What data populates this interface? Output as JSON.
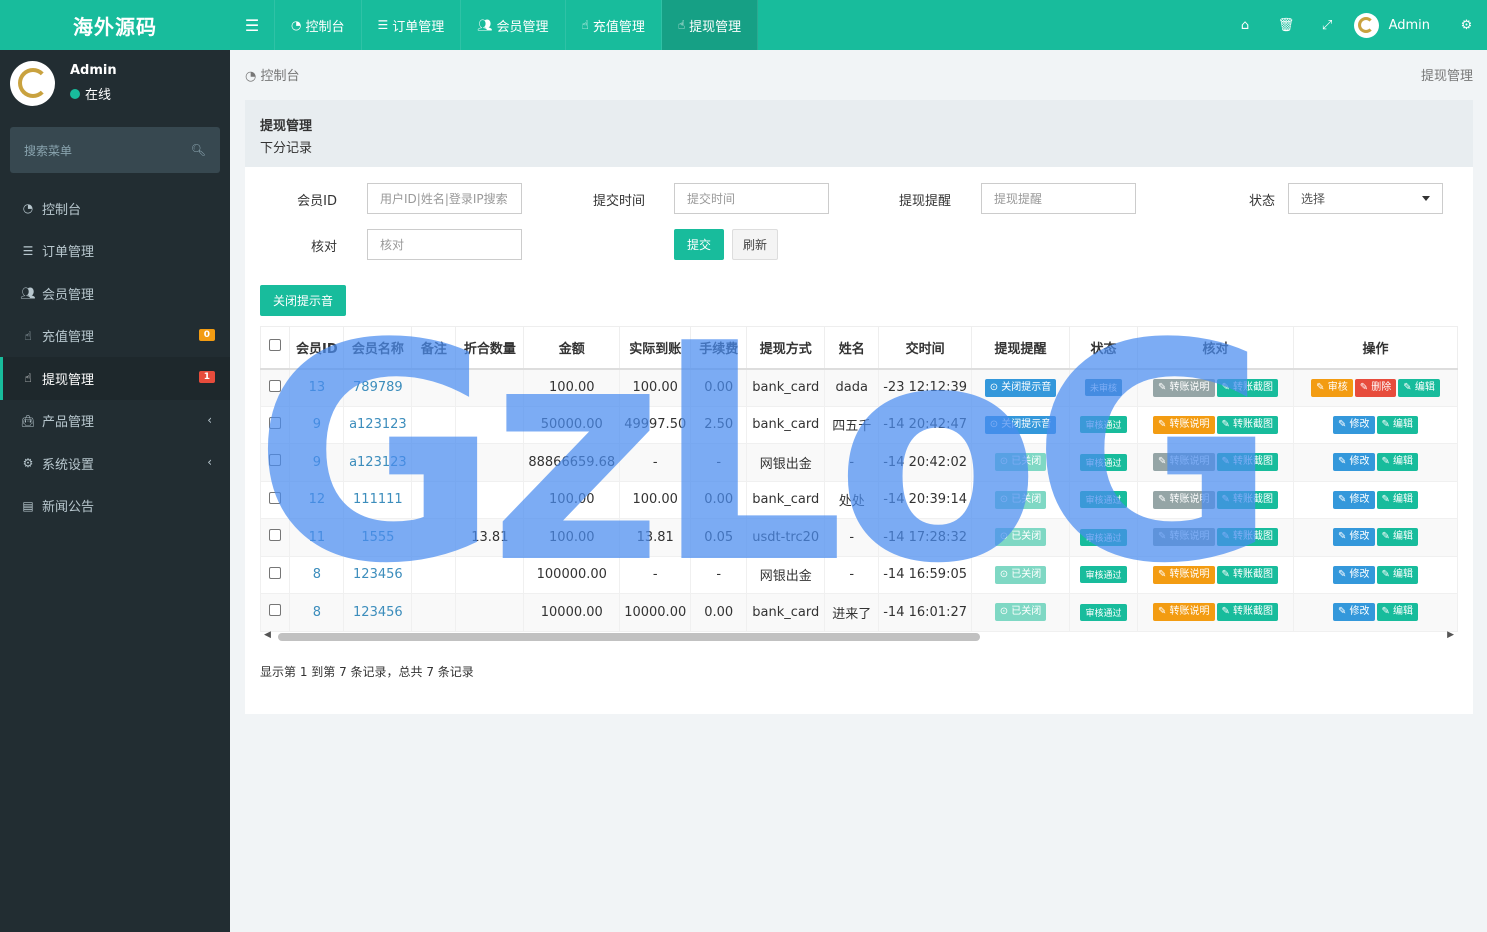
{
  "app": {
    "logo_text": "海外源码"
  },
  "user": {
    "name": "Admin",
    "status": "在线"
  },
  "sidebar": {
    "search_placeholder": "搜索菜单",
    "items": [
      {
        "label": "控制台",
        "icon": "dashboard-icon"
      },
      {
        "label": "订单管理",
        "icon": "list-icon"
      },
      {
        "label": "会员管理",
        "icon": "users-icon"
      },
      {
        "label": "充值管理",
        "icon": "hand-icon",
        "badge": "0"
      },
      {
        "label": "提现管理",
        "icon": "hand-icon",
        "badge": "1",
        "active": true
      },
      {
        "label": "产品管理",
        "icon": "shopping-bag-icon",
        "arrow": "‹"
      },
      {
        "label": "系统设置",
        "icon": "cogs-icon",
        "arrow": "‹"
      },
      {
        "label": "新闻公告",
        "icon": "newspaper-icon"
      }
    ]
  },
  "header": {
    "tabs": [
      {
        "label": "控制台"
      },
      {
        "label": "订单管理"
      },
      {
        "label": "会员管理"
      },
      {
        "label": "充值管理"
      },
      {
        "label": "提现管理",
        "active": true
      }
    ],
    "user_name": "Admin"
  },
  "breadcrumb": {
    "home": "控制台",
    "current": "提现管理"
  },
  "panel": {
    "title": "提现管理",
    "subtitle": "下分记录"
  },
  "filters": {
    "member_id_label": "会员ID",
    "member_id_placeholder": "用户ID|姓名|登录IP搜索",
    "submit_time_label": "提交时间",
    "submit_time_placeholder": "提交时间",
    "remind_label": "提现提醒",
    "remind_placeholder": "提现提醒",
    "status_label": "状态",
    "status_value": "选择",
    "check_label": "核对",
    "check_placeholder": "核对",
    "submit_button": "提交",
    "refresh_button": "刷新"
  },
  "toolbar": {
    "close_sound_button": "关闭提示音"
  },
  "table": {
    "headers": [
      "会员ID",
      "会员名称",
      "备注",
      "折合数量",
      "金额",
      "实际到账",
      "手续费",
      "提现方式",
      "姓名",
      "交时间",
      "提现提醒",
      "状态",
      "核对",
      "操作"
    ],
    "rows": [
      {
        "id": "13",
        "name": "789789",
        "note": "",
        "converted": "",
        "amount": "100.00",
        "actual": "100.00",
        "fee": "0.00",
        "method": "bank_card",
        "real_name": "dada",
        "time": "-23 12:12:39",
        "remind": "关闭提示音",
        "status": "未审核",
        "check1": "转账说明",
        "check2": "转账截图",
        "actions": [
          "审核",
          "删除",
          "编辑"
        ]
      },
      {
        "id": "9",
        "name": "a123123",
        "note": "",
        "converted": "",
        "amount": "50000.00",
        "actual": "49997.50",
        "fee": "2.50",
        "method": "bank_card",
        "real_name": "四五千",
        "time": "-14 20:42:47",
        "remind": "关闭提示音",
        "status": "审核通过",
        "check1": "转账说明",
        "check2": "转账截图",
        "actions": [
          "修改",
          "编辑"
        ]
      },
      {
        "id": "9",
        "name": "a123123",
        "note": "",
        "converted": "",
        "amount": "88866659.68",
        "actual": "-",
        "fee": "-",
        "method": "网银出金",
        "real_name": "-",
        "time": "-14 20:42:02",
        "remind": "已关闭",
        "status": "审核通过",
        "check1": "转账说明",
        "check2": "转账截图",
        "actions": [
          "修改",
          "编辑"
        ]
      },
      {
        "id": "12",
        "name": "111111",
        "note": "",
        "converted": "",
        "amount": "100.00",
        "actual": "100.00",
        "fee": "0.00",
        "method": "bank_card",
        "real_name": "处处",
        "time": "-14 20:39:14",
        "remind": "已关闭",
        "status": "审核通过",
        "check1": "转账说明",
        "check2": "转账截图",
        "actions": [
          "修改",
          "编辑"
        ]
      },
      {
        "id": "11",
        "name": "1555",
        "note": "",
        "converted": "13.81",
        "amount": "100.00",
        "actual": "13.81",
        "fee": "0.05",
        "method": "usdt-trc20",
        "real_name": "-",
        "time": "-14 17:28:32",
        "remind": "已关闭",
        "status": "审核通过",
        "check1": "转账说明",
        "check2": "转账截图",
        "actions": [
          "修改",
          "编辑"
        ]
      },
      {
        "id": "8",
        "name": "123456",
        "note": "",
        "converted": "",
        "amount": "100000.00",
        "actual": "-",
        "fee": "-",
        "method": "网银出金",
        "real_name": "-",
        "time": "-14 16:59:05",
        "remind": "已关闭",
        "status": "审核通过",
        "check1": "转账说明",
        "check2": "转账截图",
        "actions": [
          "修改",
          "编辑"
        ]
      },
      {
        "id": "8",
        "name": "123456",
        "note": "",
        "converted": "",
        "amount": "10000.00",
        "actual": "10000.00",
        "fee": "0.00",
        "method": "bank_card",
        "real_name": "进来了",
        "time": "-14 16:01:27",
        "remind": "已关闭",
        "status": "审核通过",
        "check1": "转账说明",
        "check2": "转账截图",
        "actions": [
          "修改",
          "编辑"
        ]
      }
    ]
  },
  "pager": {
    "summary": "显示第 1 到第 7 条记录，总共 7 条记录"
  },
  "watermark": {
    "text": "GzLoG"
  },
  "colors": {
    "brand": "#18bc9c",
    "sidebar": "#222d32",
    "watermark": "#4a8cf0"
  }
}
